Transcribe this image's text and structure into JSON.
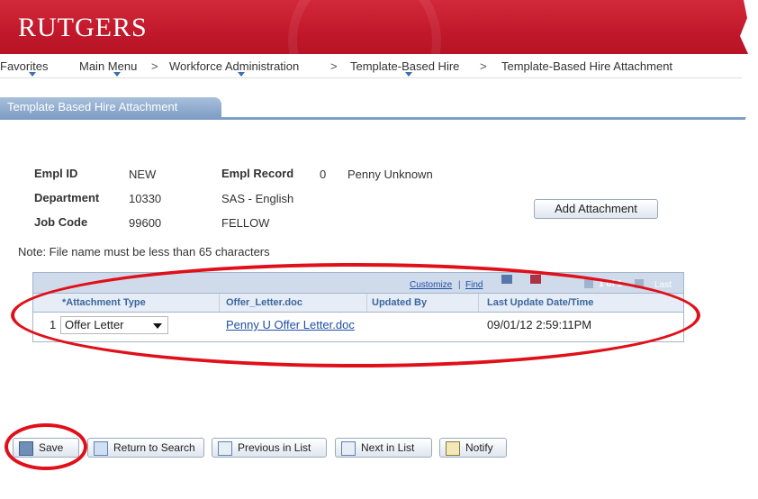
{
  "brand": {
    "logo_text": "RUTGERS"
  },
  "nav": {
    "items": [
      "Favorites",
      "Main Menu",
      "Workforce Administration",
      "Template-Based Hire",
      "Template-Based Hire Attachment"
    ],
    "separator": ">"
  },
  "tab": {
    "label": "Template Based Hire Attachment"
  },
  "fields": {
    "empl_id_label": "Empl ID",
    "empl_id_value": "NEW",
    "empl_record_label": "Empl Record",
    "empl_record_value": "0",
    "empl_name": "Penny Unknown",
    "department_label": "Department",
    "department_code": "10330",
    "department_name": "SAS - English",
    "job_code_label": "Job Code",
    "job_code_value": "99600",
    "job_code_name": "FELLOW"
  },
  "buttons": {
    "add_attachment": "Add Attachment"
  },
  "note": "Note: File name must be less than 65 characters",
  "grid": {
    "toolbar": {
      "customize": "Customize",
      "find": "Find",
      "paging": "1 of 1",
      "last": "Last"
    },
    "columns": [
      "*Attachment Type",
      "Offer_Letter.doc",
      "Updated By",
      "Last Update Date/Time"
    ],
    "rows": [
      {
        "num": "1",
        "attachment_type": "Offer Letter",
        "file": "Penny U Offer Letter.doc",
        "updated_by": "",
        "last_update": "09/01/12  2:59:11PM"
      }
    ]
  },
  "footer": {
    "save": "Save",
    "return_to_search": "Return to Search",
    "previous_in_list": "Previous in List",
    "next_in_list": "Next in List",
    "notify": "Notify"
  },
  "colors": {
    "brand_red": "#c1182b",
    "tab_blue": "#7f9fc6",
    "highlight_red": "#e0101a",
    "link_blue": "#1f4fa8"
  }
}
